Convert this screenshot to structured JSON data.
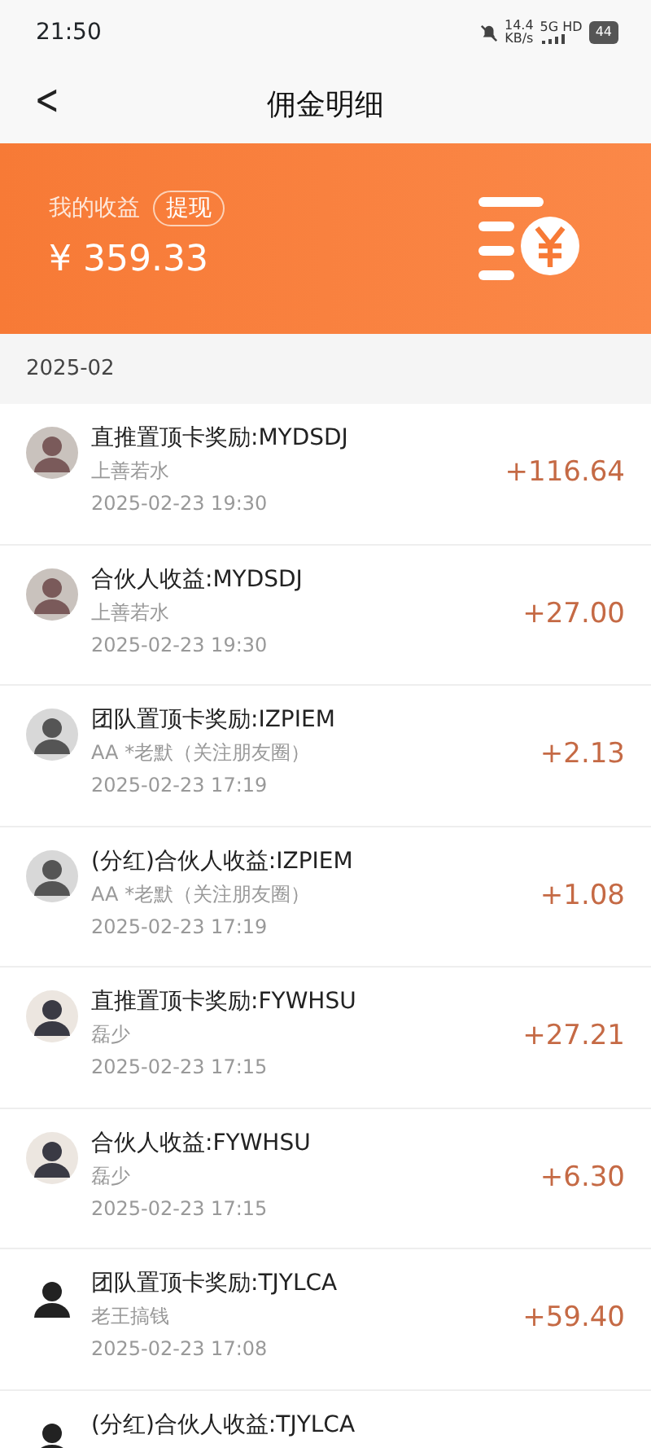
{
  "status_bar": {
    "time": "21:50",
    "speed": "14.4",
    "speed_unit": "KB/s",
    "network": "5G HD",
    "battery": "44"
  },
  "header": {
    "back": "<",
    "title": "佣金明细"
  },
  "summary": {
    "label": "我的收益",
    "withdraw": "提现",
    "amount": "¥ 359.33"
  },
  "month": "2025-02",
  "records": [
    {
      "title": "直推置顶卡奖励:MYDSDJ",
      "user": "上善若水",
      "time": "2025-02-23 19:30",
      "amount": "+116.64"
    },
    {
      "title": "合伙人收益:MYDSDJ",
      "user": "上善若水",
      "time": "2025-02-23 19:30",
      "amount": "+27.00"
    },
    {
      "title": "团队置顶卡奖励:IZPIEM",
      "user": "AA *老默（关注朋友圈）",
      "time": "2025-02-23 17:19",
      "amount": "+2.13"
    },
    {
      "title": "(分红)合伙人收益:IZPIEM",
      "user": "AA *老默（关注朋友圈）",
      "time": "2025-02-23 17:19",
      "amount": "+1.08"
    },
    {
      "title": "直推置顶卡奖励:FYWHSU",
      "user": "磊少",
      "time": "2025-02-23 17:15",
      "amount": "+27.21"
    },
    {
      "title": "合伙人收益:FYWHSU",
      "user": "磊少",
      "time": "2025-02-23 17:15",
      "amount": "+6.30"
    },
    {
      "title": "团队置顶卡奖励:TJYLCA",
      "user": "老王搞钱",
      "time": "2025-02-23 17:08",
      "amount": "+59.40"
    },
    {
      "title": "(分红)合伙人收益:TJYLCA"
    }
  ]
}
